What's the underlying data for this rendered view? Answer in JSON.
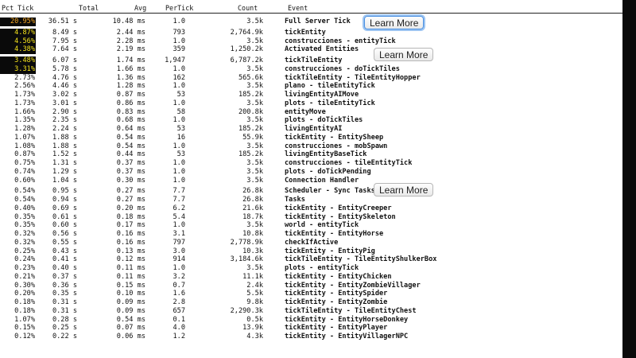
{
  "header": {
    "pct": "Pct Tick",
    "total": "Total",
    "avg": "Avg",
    "pertick": "PerTick",
    "count": "Count",
    "event": "Event"
  },
  "buttons": {
    "learn_more": "Learn More"
  },
  "rows": [
    {
      "pct": "20.95%",
      "total": "36.51 s",
      "avg": "10.48 ms",
      "pertick": "1.0",
      "count": "3.5k",
      "event": "Full Server Tick"
    },
    {
      "pct": "4.87%",
      "total": "8.49 s",
      "avg": "2.44 ms",
      "pertick": "793",
      "count": "2,764.9k",
      "event": "tickEntity"
    },
    {
      "pct": "4.56%",
      "total": "7.95 s",
      "avg": "2.28 ms",
      "pertick": "1.0",
      "count": "3.5k",
      "event": "construcciones - entityTick"
    },
    {
      "pct": "4.38%",
      "total": "7.64 s",
      "avg": "2.19 ms",
      "pertick": "359",
      "count": "1,250.2k",
      "event": "Activated Entities"
    },
    {
      "pct": "3.48%",
      "total": "6.07 s",
      "avg": "1.74 ms",
      "pertick": "1,947",
      "count": "6,787.2k",
      "event": "tickTileEntity"
    },
    {
      "pct": "3.31%",
      "total": "5.78 s",
      "avg": "1.66 ms",
      "pertick": "1.0",
      "count": "3.5k",
      "event": "construcciones - doTickTiles"
    },
    {
      "pct": "2.73%",
      "total": "4.76 s",
      "avg": "1.36 ms",
      "pertick": "162",
      "count": "565.6k",
      "event": "tickTileEntity - TileEntityHopper"
    },
    {
      "pct": "2.56%",
      "total": "4.46 s",
      "avg": "1.28 ms",
      "pertick": "1.0",
      "count": "3.5k",
      "event": "plano - tileEntityTick"
    },
    {
      "pct": "1.73%",
      "total": "3.02 s",
      "avg": "0.87 ms",
      "pertick": "53",
      "count": "185.2k",
      "event": "livingEntityAIMove"
    },
    {
      "pct": "1.73%",
      "total": "3.01 s",
      "avg": "0.86 ms",
      "pertick": "1.0",
      "count": "3.5k",
      "event": "plots - tileEntityTick"
    },
    {
      "pct": "1.66%",
      "total": "2.90 s",
      "avg": "0.83 ms",
      "pertick": "58",
      "count": "200.8k",
      "event": "entityMove"
    },
    {
      "pct": "1.35%",
      "total": "2.35 s",
      "avg": "0.68 ms",
      "pertick": "1.0",
      "count": "3.5k",
      "event": "plots - doTickTiles"
    },
    {
      "pct": "1.28%",
      "total": "2.24 s",
      "avg": "0.64 ms",
      "pertick": "53",
      "count": "185.2k",
      "event": "livingEntityAI"
    },
    {
      "pct": "1.07%",
      "total": "1.88 s",
      "avg": "0.54 ms",
      "pertick": "16",
      "count": "55.9k",
      "event": "tickEntity - EntitySheep"
    },
    {
      "pct": "1.08%",
      "total": "1.88 s",
      "avg": "0.54 ms",
      "pertick": "1.0",
      "count": "3.5k",
      "event": "construcciones - mobSpawn"
    },
    {
      "pct": "0.87%",
      "total": "1.52 s",
      "avg": "0.44 ms",
      "pertick": "53",
      "count": "185.2k",
      "event": "livingEntityBaseTick"
    },
    {
      "pct": "0.75%",
      "total": "1.31 s",
      "avg": "0.37 ms",
      "pertick": "1.0",
      "count": "3.5k",
      "event": "construcciones - tileEntityTick"
    },
    {
      "pct": "0.74%",
      "total": "1.29 s",
      "avg": "0.37 ms",
      "pertick": "1.0",
      "count": "3.5k",
      "event": "plots - doTickPending"
    },
    {
      "pct": "0.60%",
      "total": "1.04 s",
      "avg": "0.30 ms",
      "pertick": "1.0",
      "count": "3.5k",
      "event": "Connection Handler"
    },
    {
      "pct": "0.54%",
      "total": "0.95 s",
      "avg": "0.27 ms",
      "pertick": "7.7",
      "count": "26.8k",
      "event": "Scheduler - Sync Tasks"
    },
    {
      "pct": "0.54%",
      "total": "0.94 s",
      "avg": "0.27 ms",
      "pertick": "7.7",
      "count": "26.8k",
      "event": "Tasks"
    },
    {
      "pct": "0.40%",
      "total": "0.69 s",
      "avg": "0.20 ms",
      "pertick": "6.2",
      "count": "21.6k",
      "event": "tickEntity - EntityCreeper"
    },
    {
      "pct": "0.35%",
      "total": "0.61 s",
      "avg": "0.18 ms",
      "pertick": "5.4",
      "count": "18.7k",
      "event": "tickEntity - EntitySkeleton"
    },
    {
      "pct": "0.35%",
      "total": "0.60 s",
      "avg": "0.17 ms",
      "pertick": "1.0",
      "count": "3.5k",
      "event": "world - entityTick"
    },
    {
      "pct": "0.32%",
      "total": "0.56 s",
      "avg": "0.16 ms",
      "pertick": "3.1",
      "count": "10.8k",
      "event": "tickEntity - EntityHorse"
    },
    {
      "pct": "0.32%",
      "total": "0.55 s",
      "avg": "0.16 ms",
      "pertick": "797",
      "count": "2,778.9k",
      "event": "checkIfActive"
    },
    {
      "pct": "0.25%",
      "total": "0.43 s",
      "avg": "0.13 ms",
      "pertick": "3.0",
      "count": "10.3k",
      "event": "tickEntity - EntityPig"
    },
    {
      "pct": "0.24%",
      "total": "0.41 s",
      "avg": "0.12 ms",
      "pertick": "914",
      "count": "3,184.6k",
      "event": "tickTileEntity - TileEntityShulkerBox"
    },
    {
      "pct": "0.23%",
      "total": "0.40 s",
      "avg": "0.11 ms",
      "pertick": "1.0",
      "count": "3.5k",
      "event": "plots - entityTick"
    },
    {
      "pct": "0.21%",
      "total": "0.37 s",
      "avg": "0.11 ms",
      "pertick": "3.2",
      "count": "11.1k",
      "event": "tickEntity - EntityChicken"
    },
    {
      "pct": "0.30%",
      "total": "0.36 s",
      "avg": "0.15 ms",
      "pertick": "0.7",
      "count": "2.4k",
      "event": "tickEntity - EntityZombieVillager"
    },
    {
      "pct": "0.20%",
      "total": "0.35 s",
      "avg": "0.10 ms",
      "pertick": "1.6",
      "count": "5.5k",
      "event": "tickEntity - EntitySpider"
    },
    {
      "pct": "0.18%",
      "total": "0.31 s",
      "avg": "0.09 ms",
      "pertick": "2.8",
      "count": "9.8k",
      "event": "tickEntity - EntityZombie"
    },
    {
      "pct": "0.18%",
      "total": "0.31 s",
      "avg": "0.09 ms",
      "pertick": "657",
      "count": "2,290.3k",
      "event": "tickTileEntity - TileEntityChest"
    },
    {
      "pct": "1.07%",
      "total": "0.28 s",
      "avg": "0.54 ms",
      "pertick": "0.1",
      "count": "0.5k",
      "event": "tickEntity - EntityHorseDonkey"
    },
    {
      "pct": "0.15%",
      "total": "0.25 s",
      "avg": "0.07 ms",
      "pertick": "4.0",
      "count": "13.9k",
      "event": "tickEntity - EntityPlayer"
    },
    {
      "pct": "0.12%",
      "total": "0.22 s",
      "avg": "0.06 ms",
      "pertick": "1.2",
      "count": "4.3k",
      "event": "tickEntity - EntityVillagerNPC"
    }
  ]
}
